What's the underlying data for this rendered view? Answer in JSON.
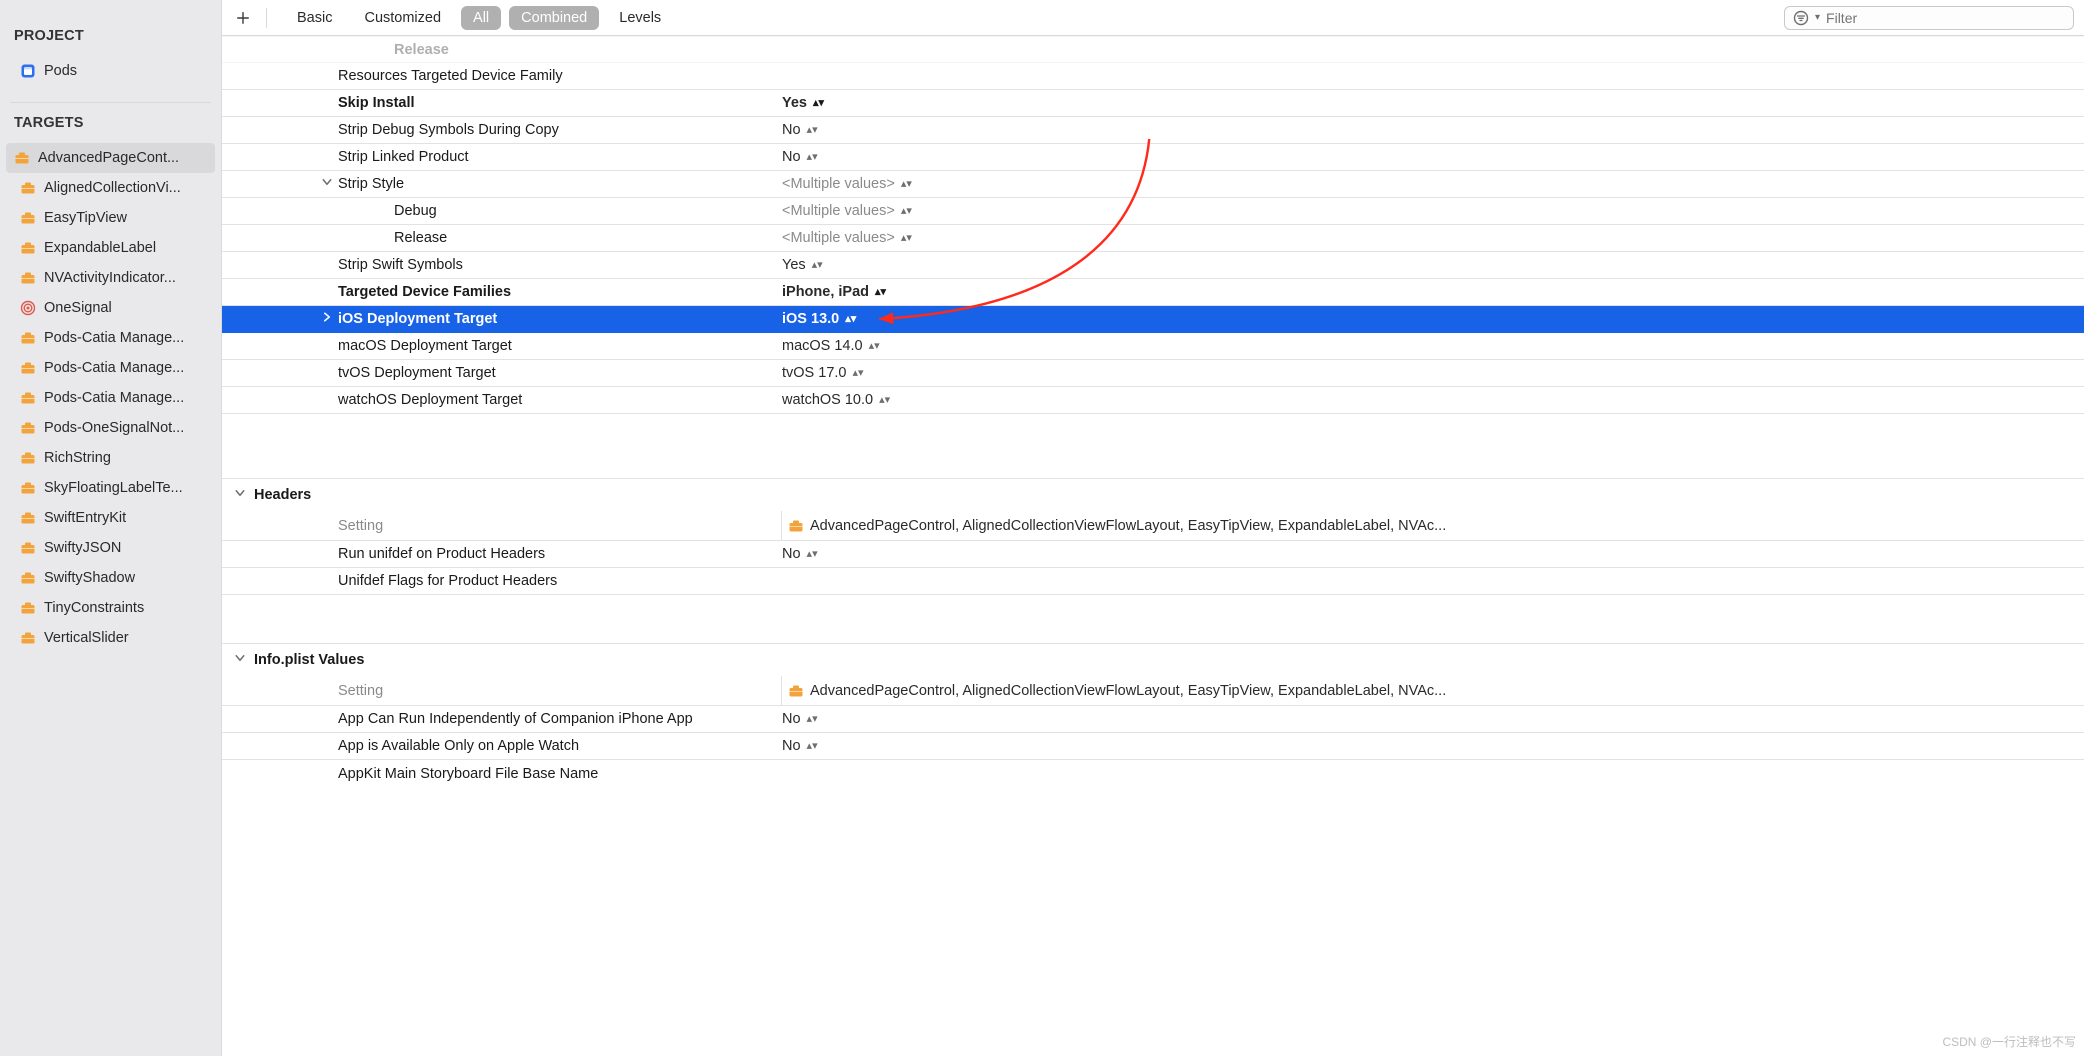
{
  "toolbar": {
    "tabs": {
      "basic": "Basic",
      "customized": "Customized",
      "all": "All",
      "combined": "Combined",
      "levels": "Levels"
    },
    "filter_placeholder": "Filter"
  },
  "sidebar": {
    "project_title": "PROJECT",
    "project_name": "Pods",
    "targets_title": "TARGETS",
    "targets": [
      {
        "label": "AdvancedPageCont...",
        "icon": "target"
      },
      {
        "label": "AlignedCollectionVi...",
        "icon": "target"
      },
      {
        "label": "EasyTipView",
        "icon": "target"
      },
      {
        "label": "ExpandableLabel",
        "icon": "target"
      },
      {
        "label": "NVActivityIndicator...",
        "icon": "target"
      },
      {
        "label": "OneSignal",
        "icon": "bullseye"
      },
      {
        "label": "Pods-Catia Manage...",
        "icon": "target"
      },
      {
        "label": "Pods-Catia Manage...",
        "icon": "target"
      },
      {
        "label": "Pods-Catia Manage...",
        "icon": "target"
      },
      {
        "label": "Pods-OneSignalNot...",
        "icon": "target"
      },
      {
        "label": "RichString",
        "icon": "target"
      },
      {
        "label": "SkyFloatingLabelTe...",
        "icon": "target"
      },
      {
        "label": "SwiftEntryKit",
        "icon": "target"
      },
      {
        "label": "SwiftyJSON",
        "icon": "target"
      },
      {
        "label": "SwiftyShadow",
        "icon": "target"
      },
      {
        "label": "TinyConstraints",
        "icon": "target"
      },
      {
        "label": "VerticalSlider",
        "icon": "target"
      }
    ]
  },
  "settings_top": {
    "release_cut": "Release",
    "rows": {
      "resources_targeted_device_family": {
        "name": "Resources Targeted Device Family",
        "value": ""
      },
      "skip_install": {
        "name": "Skip Install",
        "value": "Yes"
      },
      "strip_debug_symbols_during_copy": {
        "name": "Strip Debug Symbols During Copy",
        "value": "No"
      },
      "strip_linked_product": {
        "name": "Strip Linked Product",
        "value": "No"
      },
      "strip_style": {
        "name": "Strip Style",
        "value": "<Multiple values>"
      },
      "strip_style_debug": {
        "name": "Debug",
        "value": "<Multiple values>"
      },
      "strip_style_release": {
        "name": "Release",
        "value": "<Multiple values>"
      },
      "strip_swift_symbols": {
        "name": "Strip Swift Symbols",
        "value": "Yes"
      },
      "targeted_device_families": {
        "name": "Targeted Device Families",
        "value": "iPhone, iPad"
      },
      "ios_deployment_target": {
        "name": "iOS Deployment Target",
        "value": "iOS 13.0"
      },
      "macos_deployment_target": {
        "name": "macOS Deployment Target",
        "value": "macOS 14.0"
      },
      "tvos_deployment_target": {
        "name": "tvOS Deployment Target",
        "value": "tvOS 17.0"
      },
      "watchos_deployment_target": {
        "name": "watchOS Deployment Target",
        "value": "watchOS 10.0"
      }
    }
  },
  "section_headers": {
    "title": "Headers",
    "column_setting": "Setting",
    "column_targets": "AdvancedPageControl, AlignedCollectionViewFlowLayout, EasyTipView, ExpandableLabel, NVAc...",
    "rows": {
      "run_unifdef": {
        "name": "Run unifdef on Product Headers",
        "value": "No"
      },
      "unifdef_flags": {
        "name": "Unifdef Flags for Product Headers",
        "value": ""
      }
    }
  },
  "section_plist": {
    "title": "Info.plist Values",
    "column_setting": "Setting",
    "column_targets": "AdvancedPageControl, AlignedCollectionViewFlowLayout, EasyTipView, ExpandableLabel, NVAc...",
    "rows": {
      "companion": {
        "name": "App Can Run Independently of Companion iPhone App",
        "value": "No"
      },
      "apple_watch_only": {
        "name": "App is Available Only on Apple Watch",
        "value": "No"
      },
      "appkit_storyboard": {
        "name": "AppKit Main Storyboard File Base Name",
        "value": ""
      }
    }
  },
  "watermark": "CSDN @一行注释也不写"
}
